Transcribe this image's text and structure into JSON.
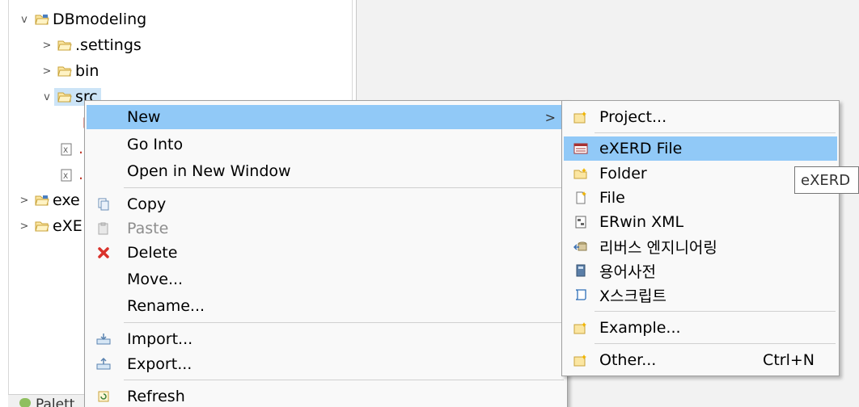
{
  "explorer": {
    "items": [
      {
        "label": "DBmodeling",
        "twisty": "v",
        "kind": "project"
      },
      {
        "label": ".settings",
        "twisty": ">",
        "kind": "folder"
      },
      {
        "label": "bin",
        "twisty": ">",
        "kind": "folder"
      },
      {
        "label": "src",
        "twisty": "v",
        "kind": "folder"
      },
      {
        "label": ".",
        "kind": "file"
      },
      {
        "label": ".",
        "kind": "file"
      },
      {
        "label": "exe",
        "twisty": ">",
        "kind": "project"
      },
      {
        "label": "eXE",
        "twisty": ">",
        "kind": "project"
      }
    ],
    "bottom_tab": "Palett"
  },
  "context_menu": {
    "items": [
      {
        "label": "New",
        "icon": "",
        "highlighted": true,
        "has_submenu": true
      },
      {
        "label": "Go Into",
        "icon": ""
      },
      {
        "label": "Open in New Window",
        "icon": ""
      },
      {
        "label": "Copy",
        "icon": "copy-icon"
      },
      {
        "label": "Paste",
        "icon": "paste-icon",
        "disabled": true
      },
      {
        "label": "Delete",
        "icon": "delete-icon"
      },
      {
        "label": "Move...",
        "icon": ""
      },
      {
        "label": "Rename...",
        "icon": ""
      },
      {
        "label": "Import...",
        "icon": "import-icon"
      },
      {
        "label": "Export...",
        "icon": "export-icon"
      },
      {
        "label": "Refresh",
        "icon": "refresh-icon"
      }
    ],
    "submenu_arrow": ">"
  },
  "new_submenu": {
    "items": [
      {
        "label": "Project...",
        "icon": "new-project-icon"
      },
      {
        "label": "eXERD File",
        "icon": "exerd-file-icon",
        "highlighted": true
      },
      {
        "label": "Folder",
        "icon": "new-folder-icon"
      },
      {
        "label": "File",
        "icon": "new-file-icon"
      },
      {
        "label": "ERwin XML",
        "icon": "erwin-xml-icon"
      },
      {
        "label": "리버스 엔지니어링",
        "icon": "reverse-engineering-icon"
      },
      {
        "label": "용어사전",
        "icon": "glossary-icon"
      },
      {
        "label": "X스크립트",
        "icon": "xscript-icon"
      },
      {
        "label": "Example...",
        "icon": "example-icon"
      },
      {
        "label": "Other...",
        "icon": "other-icon",
        "shortcut": "Ctrl+N"
      }
    ]
  },
  "tooltip": {
    "text": "eXERD"
  },
  "colors": {
    "highlight": "#91c9f7",
    "selection": "#cce4f7",
    "menu_bg": "#f9f9f9",
    "delete_red": "#d9322b"
  }
}
